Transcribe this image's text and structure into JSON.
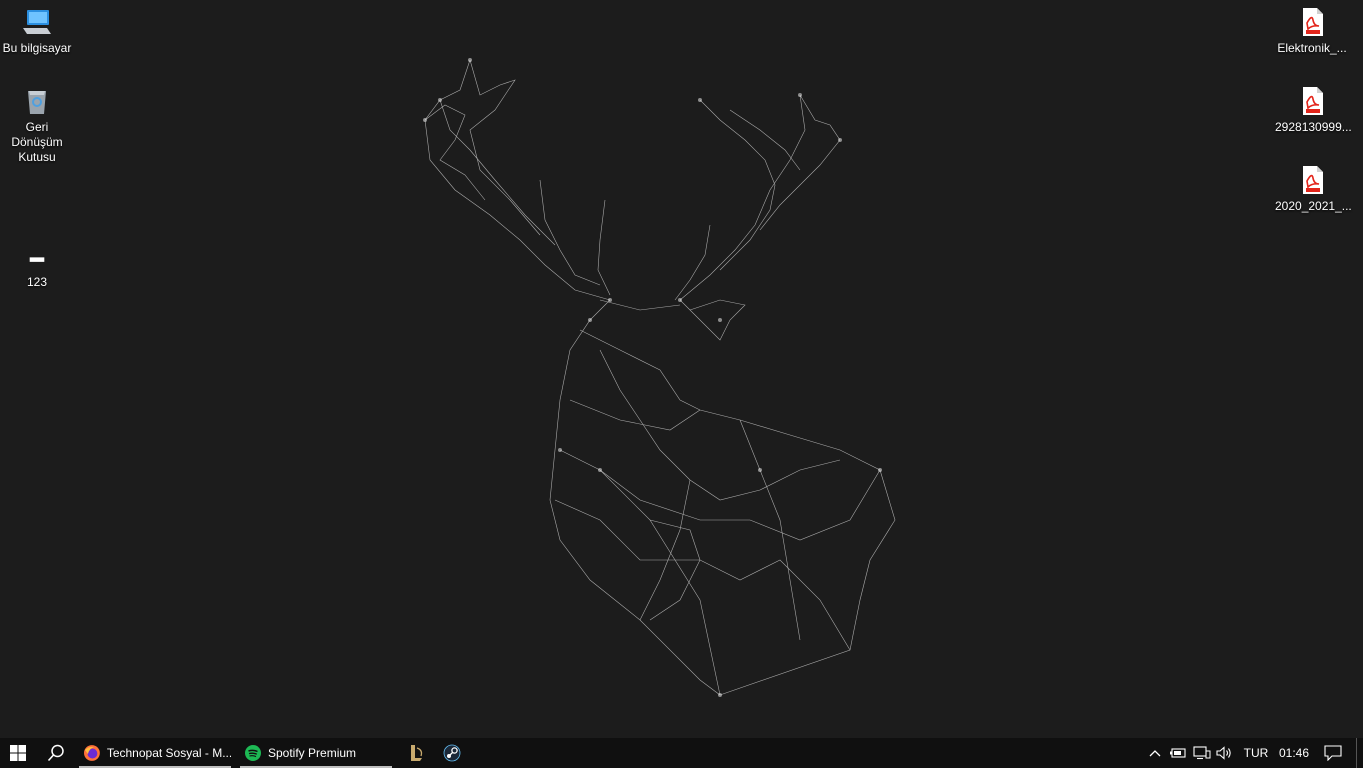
{
  "desktop": {
    "left_icons": [
      {
        "label": "Bu bilgisayar",
        "icon": "computer-icon"
      },
      {
        "label": "Geri Dönüşüm Kutusu",
        "icon": "recycle-bin-icon"
      },
      {
        "label": "123",
        "icon": "folder-shortcut-icon"
      }
    ],
    "right_icons": [
      {
        "label": "Elektronik_...",
        "icon": "pdf-file-icon"
      },
      {
        "label": "2928130999...",
        "icon": "pdf-file-icon"
      },
      {
        "label": "2020_2021_...",
        "icon": "pdf-file-icon"
      }
    ],
    "wallpaper": "deer-wireframe-wallpaper"
  },
  "taskbar": {
    "start_icon": "windows-start-icon",
    "search_icon": "search-icon",
    "apps": [
      {
        "label": "Technopat Sosyal - M...",
        "icon": "firefox-icon",
        "active": true
      },
      {
        "label": "Spotify Premium",
        "icon": "spotify-icon",
        "active": true
      }
    ],
    "pinned": [
      {
        "icon": "league-of-legends-icon"
      },
      {
        "icon": "steam-icon"
      }
    ],
    "tray": {
      "language": "TUR",
      "time": "01:46"
    }
  },
  "colors": {
    "desktop_bg": "#1c1c1c",
    "taskbar_bg": "#101010",
    "pdf_red": "#e3251b",
    "spotify_green": "#1db954"
  }
}
